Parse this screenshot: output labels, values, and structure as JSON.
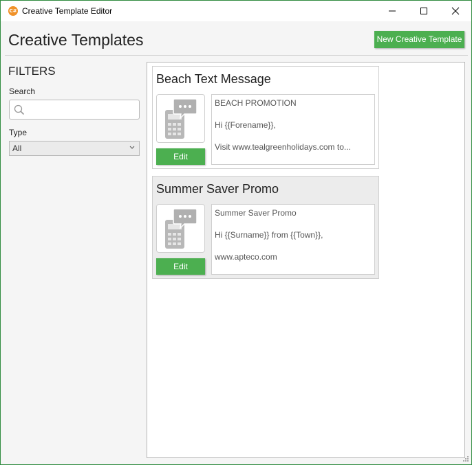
{
  "window": {
    "title": "Creative Template Editor",
    "app_icon_text": "C#"
  },
  "header": {
    "title": "Creative Templates",
    "new_button_label": "New Creative Template"
  },
  "filters": {
    "heading": "FILTERS",
    "search_label": "Search",
    "search_value": "",
    "type_label": "Type",
    "type_selected": "All"
  },
  "templates": [
    {
      "title": "Beach Text Message",
      "edit_label": "Edit",
      "preview": [
        "BEACH PROMOTION",
        "Hi {{Forename}},",
        "Visit www.tealgreenholidays.com to..."
      ],
      "selected": false
    },
    {
      "title": "Summer Saver Promo",
      "edit_label": "Edit",
      "preview": [
        "Summer Saver Promo",
        "Hi {{Surname}} from {{Town}},",
        "www.apteco.com"
      ],
      "selected": true
    }
  ],
  "icons": {
    "app": "app-logo-icon",
    "template": "sms-phone-icon",
    "search": "search-icon",
    "dropdown": "chevron-down-icon"
  },
  "colors": {
    "accent": "#4caf50",
    "window_border": "#2e8b3e",
    "app_icon": "#f0922a"
  }
}
